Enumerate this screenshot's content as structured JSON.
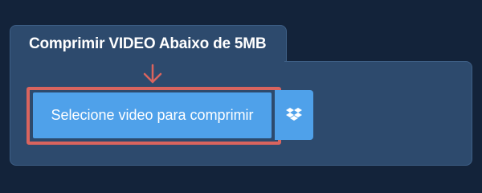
{
  "panel": {
    "title": "Comprimir VIDEO Abaixo de 5MB"
  },
  "upload": {
    "button_label": "Selecione video para comprimir",
    "dropbox_icon": "dropbox-icon",
    "arrow_icon": "arrow-down-icon"
  },
  "colors": {
    "background": "#13233a",
    "panel": "#2d4a6d",
    "button": "#4fa1ea",
    "highlight": "#d9645e",
    "text": "#ffffff"
  }
}
